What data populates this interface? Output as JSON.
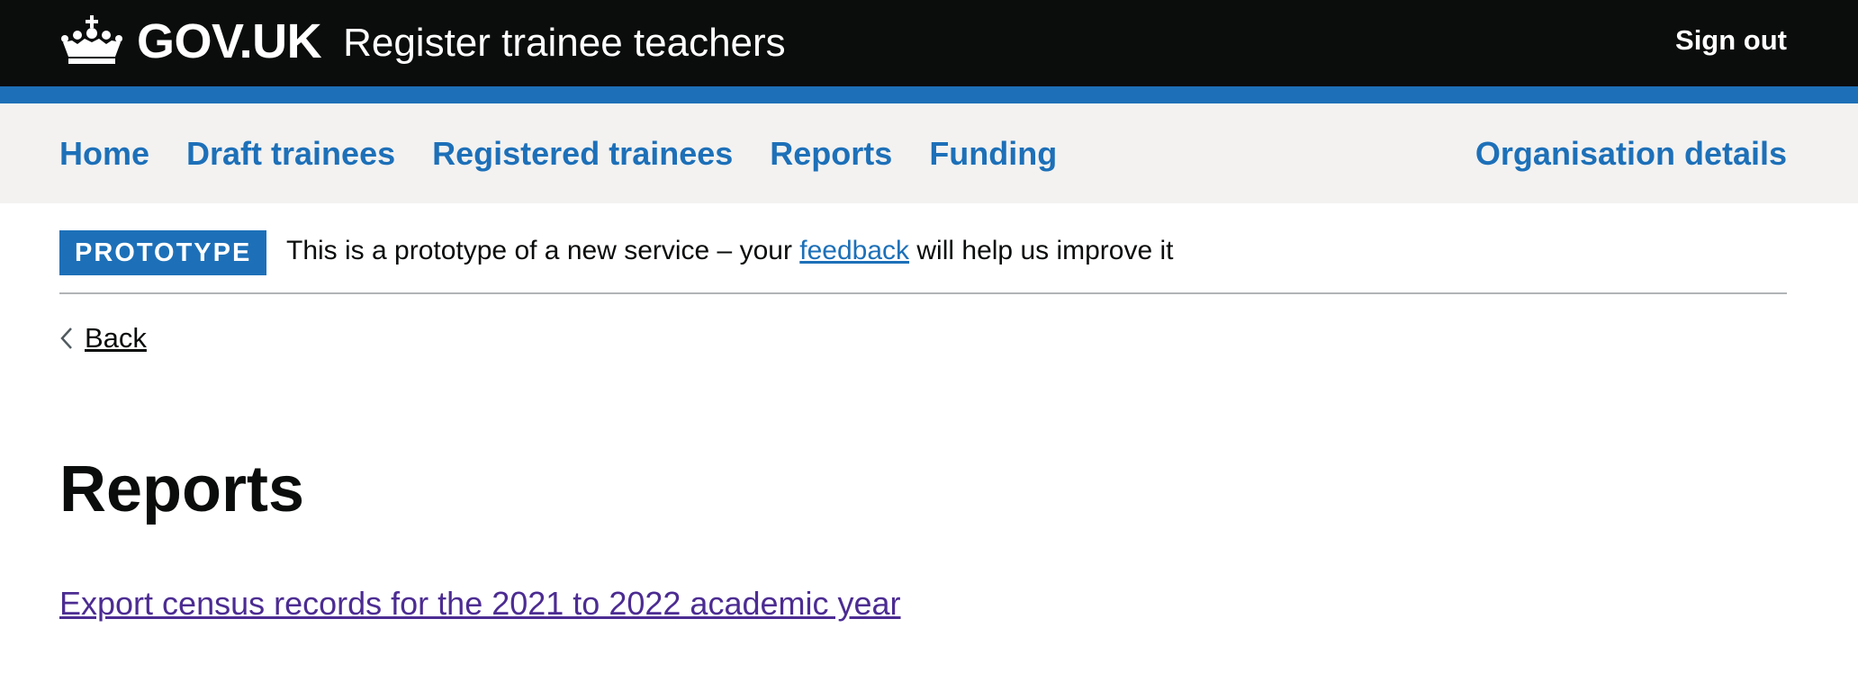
{
  "header": {
    "brand": "GOV.UK",
    "service_name": "Register trainee teachers",
    "sign_out": "Sign out",
    "icons": {
      "logo": "crown-icon"
    }
  },
  "nav": {
    "items": [
      {
        "label": "Home"
      },
      {
        "label": "Draft trainees"
      },
      {
        "label": "Registered trainees"
      },
      {
        "label": "Reports"
      },
      {
        "label": "Funding"
      }
    ],
    "right_item": {
      "label": "Organisation details"
    }
  },
  "phase_banner": {
    "tag": "PROTOTYPE",
    "text_before": "This is a prototype of a new service – your",
    "link": "feedback",
    "text_after": "will help us improve it"
  },
  "back_link": {
    "label": "Back",
    "icon": "chevron-left-icon"
  },
  "main": {
    "title": "Reports",
    "export_link": "Export census records for the 2021 to 2022 academic year"
  },
  "colors": {
    "header_bg": "#0b0c0c",
    "accent": "#1d70b8",
    "nav_bg": "#f3f2f1",
    "visited_link": "#4c2c92"
  }
}
